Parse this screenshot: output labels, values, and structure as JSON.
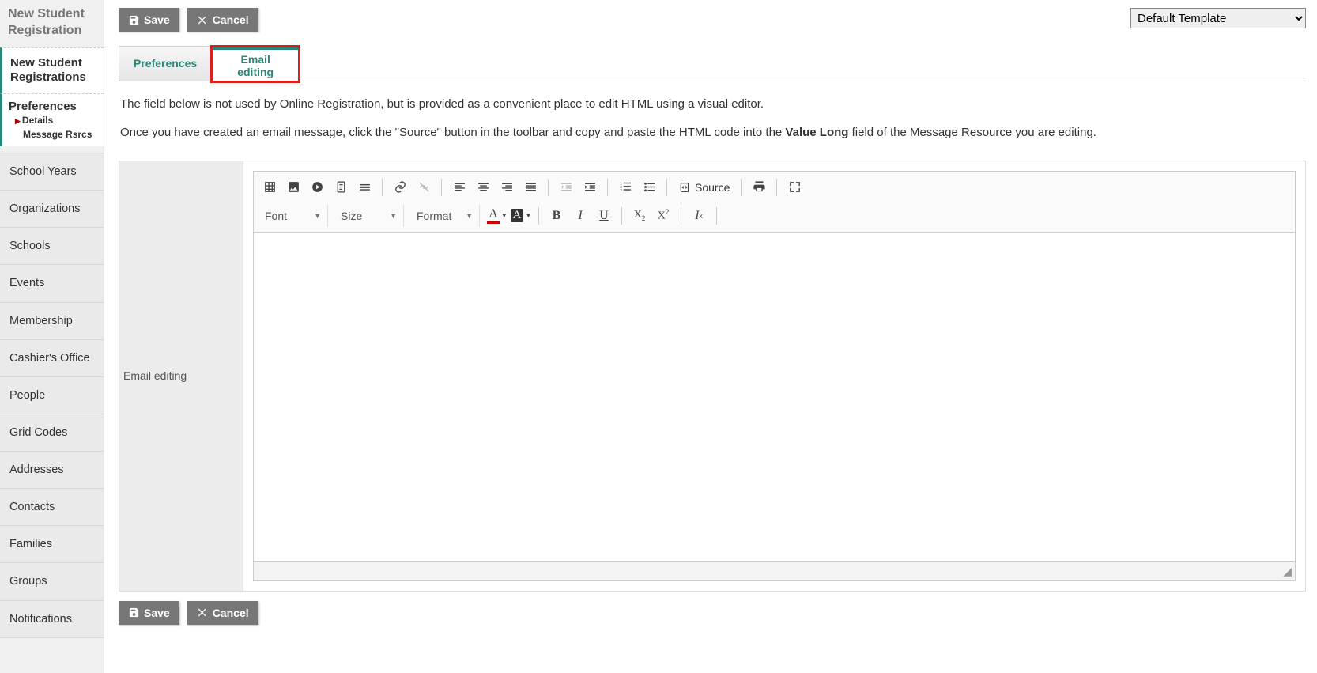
{
  "app_title_l1": "New Student",
  "app_title_l2": "Registration",
  "sidebar": {
    "active_section_l1": "New Student",
    "active_section_l2": "Registrations",
    "pref_label": "Preferences",
    "pref_sub1": "Details",
    "pref_sub2": "Message Rsrcs",
    "items": [
      "School Years",
      "Organizations",
      "Schools",
      "Events",
      "Membership",
      "Cashier's Office",
      "People",
      "Grid Codes",
      "Addresses",
      "Contacts",
      "Families",
      "Groups",
      "Notifications"
    ]
  },
  "buttons": {
    "save": "Save",
    "cancel": "Cancel"
  },
  "template_select": "Default Template",
  "tabs": {
    "preferences": "Preferences",
    "email_l1": "Email",
    "email_l2": "editing"
  },
  "instructions": {
    "p1": "The field below is not used by Online Registration, but is provided as a convenient place to edit HTML using a visual editor.",
    "p2a": "Once you have created an email message, click the \"Source\" button in the toolbar and copy and paste the HTML code into the ",
    "p2b": "Value Long",
    "p2c": " field of the Message Resource you are editing."
  },
  "editor": {
    "side_label": "Email editing",
    "source_label": "Source",
    "combo_font": "Font",
    "combo_size": "Size",
    "combo_format": "Format"
  }
}
